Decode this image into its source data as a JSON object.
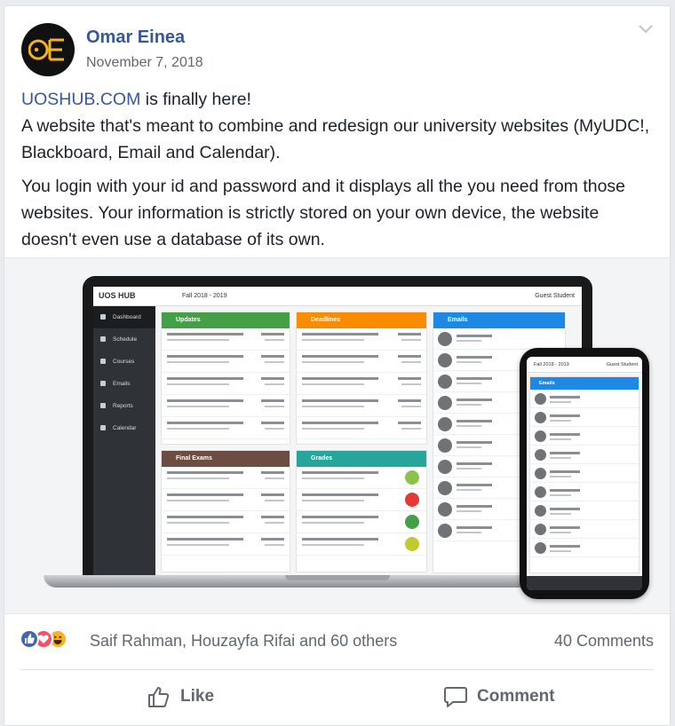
{
  "post": {
    "author": "Omar Einea",
    "date": "November 7, 2018",
    "text": {
      "link": "UOSHUB.COM",
      "line1_rest": " is finally here!",
      "line2": "A website that's meant to combine and redesign our university websites (MyUDC!, Blackboard, Email and Calendar).",
      "line3": "You login with your id and password and it displays all the you need from those websites. Your information is strictly stored on your own device, the website doesn't even use a database of its own."
    }
  },
  "screenshot": {
    "logo": "UOS HUB",
    "semester": "Fall 2018 - 2019",
    "user": "Guest Student",
    "sidebar": [
      "Dashboard",
      "Schedule",
      "Courses",
      "Emails",
      "Reports",
      "Calendar"
    ],
    "panels": {
      "updates": "Updates",
      "deadlines": "Deadlines",
      "emails": "Emails",
      "final_exams": "Final Exams",
      "grades": "Grades"
    },
    "phone_panel": "Emails",
    "colors": {
      "updates": "#43a047",
      "deadlines": "#fb8c00",
      "emails": "#1e88e5",
      "final_exams": "#6d4c41",
      "grades": "#26a69a"
    }
  },
  "stats": {
    "reaction_icons": [
      "like-icon",
      "love-icon",
      "haha-icon"
    ],
    "names": "Saif Rahman, Houzayfa Rifai and 60 others",
    "comments": "40 Comments"
  },
  "actions": {
    "like": "Like",
    "comment": "Comment"
  }
}
